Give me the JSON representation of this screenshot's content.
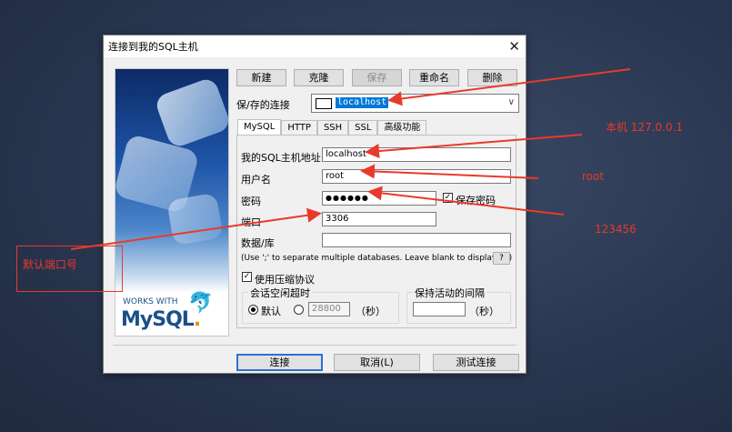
{
  "window": {
    "title": "连接到我的SQL主机",
    "close_glyph": "✕"
  },
  "logo": {
    "works_with": "WORKS WITH",
    "brand": "MySQL",
    "brand_dot": "."
  },
  "toolbar": {
    "new": "新建",
    "clone": "克隆",
    "save": "保存",
    "rename": "重命名",
    "delete": "删除"
  },
  "saved_connection": {
    "label": "保/存的连接",
    "value": "localhost"
  },
  "tabs": [
    "MySQL",
    "HTTP",
    "SSH",
    "SSL",
    "高级功能"
  ],
  "form": {
    "host_label": "我的SQL主机地址",
    "host_value": "localhost",
    "user_label": "用户名",
    "user_value": "root",
    "password_label": "密码",
    "password_value": "●●●●●●",
    "save_password_label": "保存密码",
    "port_label": "端口",
    "port_value": "3306",
    "database_label": "数据/库",
    "database_value": "",
    "database_hint": "(Use ';' to separate multiple databases. Leave blank to display all)",
    "help": "?",
    "compress_label": "使用压缩协议",
    "timeout_group": "会话空闲超时",
    "default_label": "默认",
    "timeout_value": "28800",
    "seconds": "（秒）",
    "keepalive_group": "保持活动的间隔",
    "keepalive_value": "",
    "seconds2": "（秒）"
  },
  "footer": {
    "connect": "连接",
    "cancel": "取消(L)",
    "test": "测试连接"
  },
  "annotations": {
    "host_note": "本机 127.0.0.1",
    "user_note": "root",
    "password_note": "123456",
    "port_note": "默认端口号"
  },
  "colors": {
    "accent": "#0078d7",
    "annotation": "#e83a2a"
  }
}
